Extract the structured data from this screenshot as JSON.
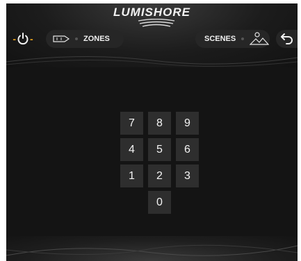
{
  "header": {
    "logo_text": "LUMISHORE",
    "zones_label": "ZONES",
    "scenes_label": "SCENES"
  },
  "icons": {
    "power": "power-icon",
    "boat": "boat-icon",
    "scenes": "scenes-icon",
    "back": "back-arrow-icon"
  },
  "colors": {
    "accent": "#e8a21c",
    "key_bg": "#2e2e2e",
    "background": "#141414"
  },
  "keypad": {
    "k7": "7",
    "k8": "8",
    "k9": "9",
    "k4": "4",
    "k5": "5",
    "k6": "6",
    "k1": "1",
    "k2": "2",
    "k3": "3",
    "k0": "0"
  }
}
